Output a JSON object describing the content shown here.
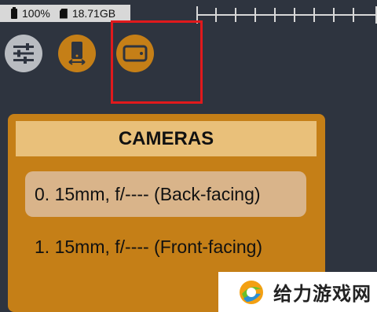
{
  "status_bar": {
    "battery": "100%",
    "storage": "18.71GB"
  },
  "toolbar": {
    "settings_icon": "sliders-icon",
    "orientation_icon": "phone-rotate-icon",
    "camera_switch_icon": "landscape-camera-icon"
  },
  "cameras_dialog": {
    "title": "CAMERAS",
    "options": [
      {
        "label": "0. 15mm, f/---- (Back-facing)",
        "selected": true
      },
      {
        "label": "1. 15mm, f/---- (Front-facing)",
        "selected": false
      }
    ]
  },
  "watermark": {
    "text": "给力游戏网"
  },
  "colors": {
    "background": "#2e343f",
    "accent": "#c57f17",
    "header": "#e9c07a",
    "selected_option": "#d9b48a",
    "highlight": "#e0191c"
  }
}
